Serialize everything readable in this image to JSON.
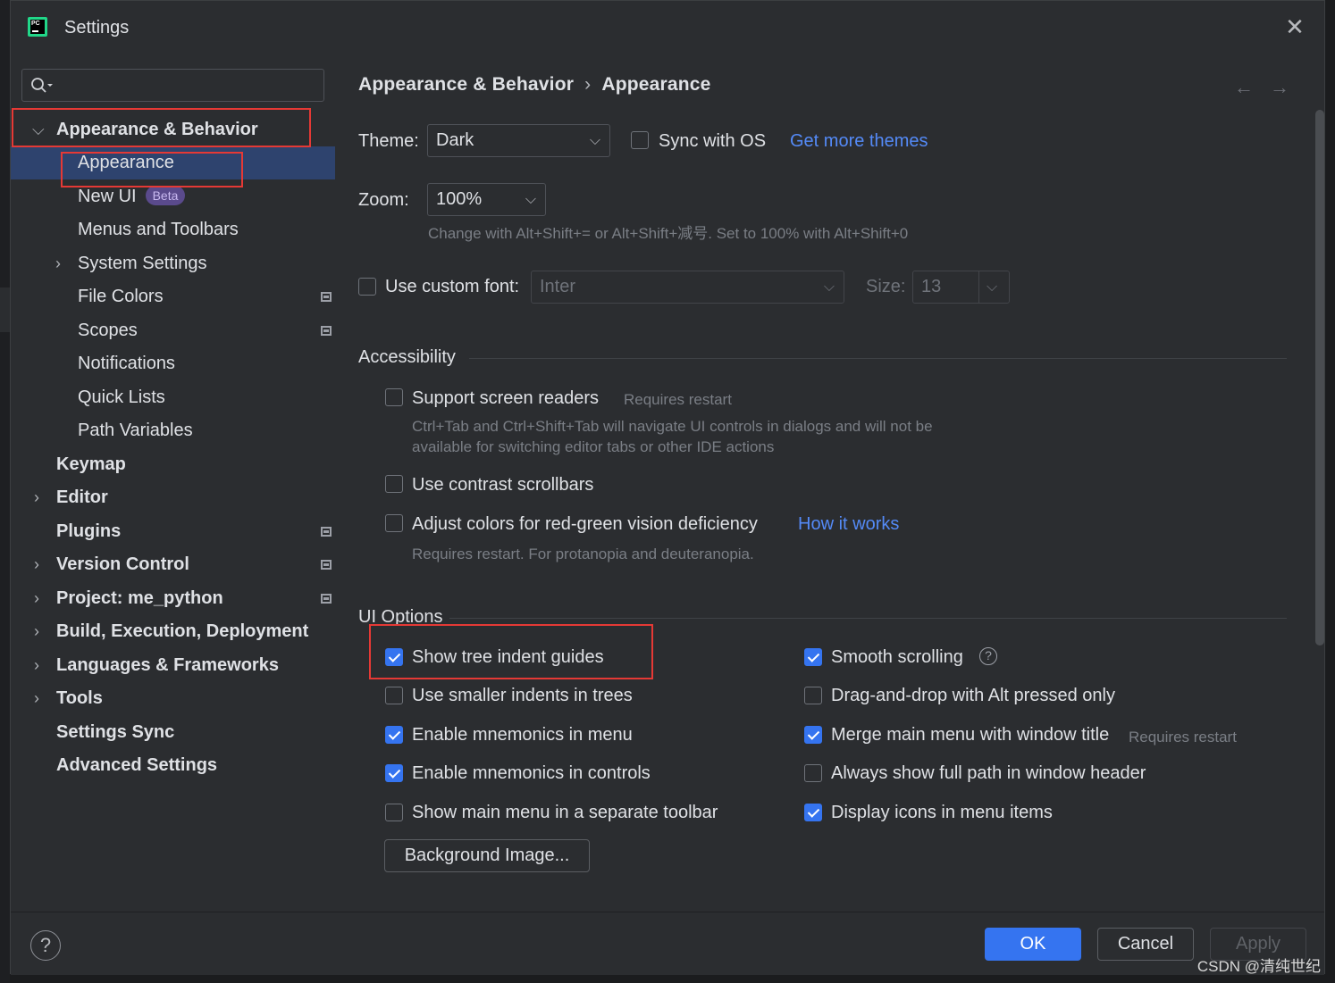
{
  "window": {
    "title": "Settings",
    "app_logo_text": "PC"
  },
  "search": {
    "placeholder": ""
  },
  "sidebar": {
    "items": [
      {
        "label": "Appearance & Behavior",
        "level": 0,
        "expanded": true
      },
      {
        "label": "Appearance",
        "level": 1,
        "selected": true
      },
      {
        "label": "New UI",
        "level": 1,
        "badge": "Beta"
      },
      {
        "label": "Menus and Toolbars",
        "level": 1
      },
      {
        "label": "System Settings",
        "level": 1,
        "expandable": true
      },
      {
        "label": "File Colors",
        "level": 1,
        "icon": "project-settings-icon"
      },
      {
        "label": "Scopes",
        "level": 1,
        "icon": "project-settings-icon"
      },
      {
        "label": "Notifications",
        "level": 1
      },
      {
        "label": "Quick Lists",
        "level": 1
      },
      {
        "label": "Path Variables",
        "level": 1
      },
      {
        "label": "Keymap",
        "level": 0
      },
      {
        "label": "Editor",
        "level": 0,
        "expandable": true
      },
      {
        "label": "Plugins",
        "level": 0,
        "icon": "project-settings-icon"
      },
      {
        "label": "Version Control",
        "level": 0,
        "expandable": true,
        "icon": "project-settings-icon"
      },
      {
        "label": "Project: me_python",
        "level": 0,
        "expandable": true,
        "icon": "project-settings-icon"
      },
      {
        "label": "Build, Execution, Deployment",
        "level": 0,
        "expandable": true
      },
      {
        "label": "Languages & Frameworks",
        "level": 0,
        "expandable": true
      },
      {
        "label": "Tools",
        "level": 0,
        "expandable": true
      },
      {
        "label": "Settings Sync",
        "level": 0
      },
      {
        "label": "Advanced Settings",
        "level": 0
      }
    ]
  },
  "breadcrumb": {
    "parent": "Appearance & Behavior",
    "separator": "›",
    "current": "Appearance"
  },
  "nav": {
    "back": "←",
    "forward": "→"
  },
  "theme": {
    "label": "Theme:",
    "value": "Dark",
    "sync_label": "Sync with OS",
    "sync_checked": false,
    "more_link": "Get more themes"
  },
  "zoom": {
    "label": "Zoom:",
    "value": "100%",
    "hint": "Change with Alt+Shift+= or Alt+Shift+减号. Set to 100% with Alt+Shift+0"
  },
  "custom_font": {
    "label": "Use custom font:",
    "checked": false,
    "font_value": "Inter",
    "size_label": "Size:",
    "size_value": "13"
  },
  "accessibility": {
    "title": "Accessibility",
    "screen_readers": {
      "label": "Support screen readers",
      "checked": false,
      "note": "Requires restart",
      "desc_line1": "Ctrl+Tab and Ctrl+Shift+Tab will navigate UI controls in dialogs and will not be",
      "desc_line2": "available for switching editor tabs or other IDE actions"
    },
    "contrast_scrollbars": {
      "label": "Use contrast scrollbars",
      "checked": false
    },
    "red_green": {
      "label": "Adjust colors for red-green vision deficiency",
      "checked": false,
      "link": "How it works",
      "desc": "Requires restart. For protanopia and deuteranopia."
    }
  },
  "ui_options": {
    "title": "UI Options",
    "left": [
      {
        "label": "Show tree indent guides",
        "checked": true
      },
      {
        "label": "Use smaller indents in trees",
        "checked": false
      },
      {
        "label": "Enable mnemonics in menu",
        "checked": true
      },
      {
        "label": "Enable mnemonics in controls",
        "checked": true
      },
      {
        "label": "Show main menu in a separate toolbar",
        "checked": false
      }
    ],
    "right": [
      {
        "label": "Smooth scrolling",
        "checked": true,
        "help": "?"
      },
      {
        "label": "Drag-and-drop with Alt pressed only",
        "checked": false
      },
      {
        "label": "Merge main menu with window title",
        "checked": true,
        "note": "Requires restart"
      },
      {
        "label": "Always show full path in window header",
        "checked": false
      },
      {
        "label": "Display icons in menu items",
        "checked": true
      }
    ],
    "background_button": "Background Image..."
  },
  "footer": {
    "help": "?",
    "ok": "OK",
    "cancel": "Cancel",
    "apply": "Apply"
  },
  "watermark": "CSDN @清纯世纪",
  "colors": {
    "accent": "#3574f0",
    "selection": "#2e436e",
    "link": "#548af7",
    "annotation": "#e53935",
    "background": "#2b2d30"
  }
}
